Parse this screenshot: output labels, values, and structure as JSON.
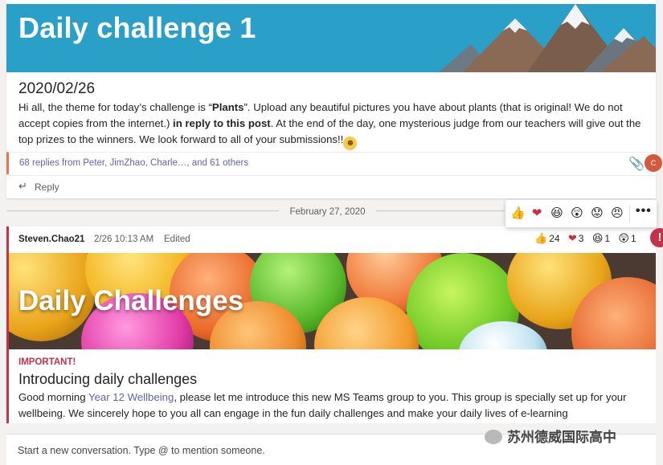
{
  "post1": {
    "banner_title": "Daily challenge 1",
    "date_heading": "2020/02/26",
    "body": {
      "part1": "Hi all, the theme for today’s challenge is “",
      "bold1": "Plants",
      "part2": "”. Upload any beautiful pictures you have about plants (that is original! We do not accept copies from the internet.) ",
      "bold2": "in reply to this post",
      "part3": ". At the end of the day, one mysterious judge from our teachers will give out the top prizes to the winners. We look forward to all of your submissions!!"
    },
    "replies_summary": "68 replies from Peter, JimZhao, Charle…, and 61 others",
    "reply_label": "Reply",
    "avatar_initials": "C"
  },
  "divider": {
    "date": "February 27, 2020"
  },
  "reaction_bar": {
    "reactions": [
      "like-icon",
      "heart-icon",
      "laugh-icon",
      "surprised-icon",
      "sad-icon",
      "angry-icon"
    ],
    "more_label": "•••"
  },
  "post2": {
    "author": "Steven.Chao21",
    "time": "2/26 10:13 AM",
    "edited": "Edited",
    "reactions": [
      {
        "icon": "like-icon",
        "count": "24"
      },
      {
        "icon": "heart-icon",
        "count": "3"
      },
      {
        "icon": "laugh-icon",
        "count": "1"
      },
      {
        "icon": "surprised-icon",
        "count": "1"
      }
    ],
    "banner_title": "Daily Challenges",
    "important_label": "IMPORTANT!",
    "subject": "Introducing daily challenges",
    "intro": {
      "part1": "Good morning ",
      "link": "Year 12 Wellbeing",
      "part2": ", please let me introduce this new MS Teams group to you. This group is specially set up for your wellbeing. We sincerely hope to you all can engage in the fun daily challenges and make your daily lives of e-learning"
    }
  },
  "compose": {
    "placeholder": "Start a new conversation. Type @ to mention someone."
  },
  "watermark": {
    "text": "苏州德威国际高中"
  },
  "colors": {
    "accent": "#6264a7",
    "important": "#c4314b",
    "banner1": "#2aa0c8",
    "thread_mark": "#e97548"
  }
}
